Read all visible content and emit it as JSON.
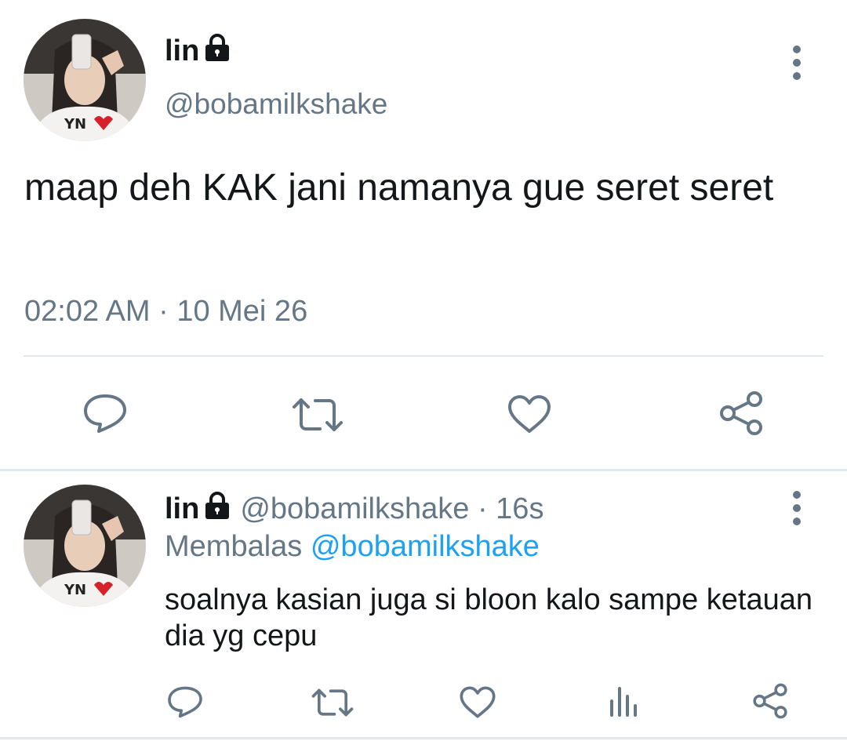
{
  "tweet": {
    "author_name": "lin",
    "author_handle": "@bobamilkshake",
    "text": "maap deh KAK jani namanya gue seret seret",
    "timestamp": "02:02 AM · 10 Mei 26",
    "more_icon": "vertical-dots-icon",
    "actions": [
      {
        "name": "reply",
        "icon": "reply-bubble-icon"
      },
      {
        "name": "retweet",
        "icon": "retweet-icon"
      },
      {
        "name": "like",
        "icon": "heart-icon"
      },
      {
        "name": "share",
        "icon": "share-icon"
      }
    ]
  },
  "reply": {
    "author_name": "lin",
    "author_handle": "@bobamilkshake",
    "separator": "·",
    "time_ago": "16s",
    "replying_label": "Membalas",
    "replying_to": "@bobamilkshake",
    "text": "soalnya kasian juga si bloon kalo sampe ketauan dia yg cepu",
    "actions": [
      {
        "name": "reply",
        "icon": "reply-bubble-icon"
      },
      {
        "name": "retweet",
        "icon": "retweet-icon"
      },
      {
        "name": "like",
        "icon": "heart-icon"
      },
      {
        "name": "analytics",
        "icon": "bar-chart-icon"
      },
      {
        "name": "share",
        "icon": "share-icon"
      }
    ]
  },
  "colors": {
    "text": "#14171a",
    "secondary": "#657786",
    "link": "#1da1f2",
    "divider": "#e1e8ed"
  }
}
